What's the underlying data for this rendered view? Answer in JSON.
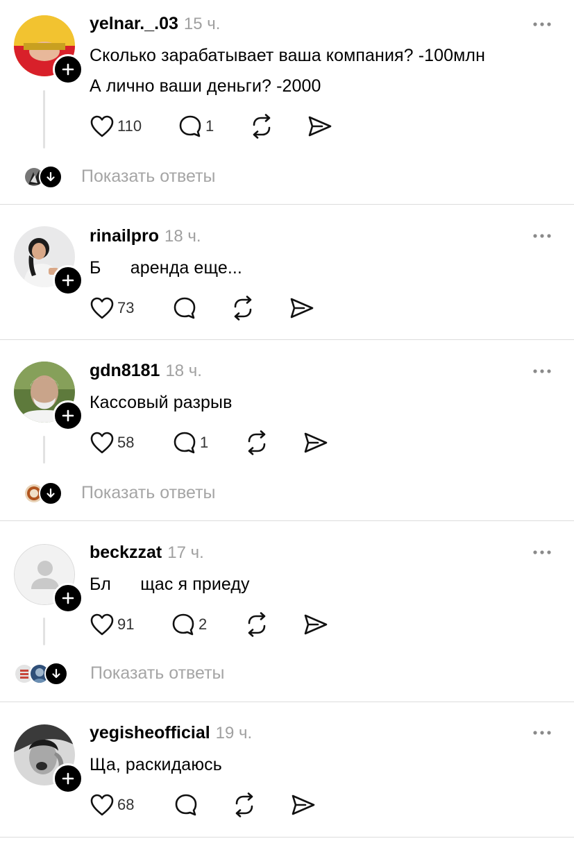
{
  "posts": [
    {
      "username": "yelnar._.03",
      "time": "15 ч.",
      "lines": [
        "Сколько  зарабатывает ваша компания? -100млн",
        "А лично ваши деньги? -2000"
      ],
      "likes": "110",
      "comments": "1",
      "show_replies": "Показать ответы"
    },
    {
      "username": "rinailpro",
      "time": "18 ч.",
      "lines": [
        "Б      аренда еще..."
      ],
      "likes": "73",
      "comments": ""
    },
    {
      "username": "gdn8181",
      "time": "18 ч.",
      "lines": [
        "Кассовый разрыв"
      ],
      "likes": "58",
      "comments": "1",
      "show_replies": "Показать ответы"
    },
    {
      "username": "beckzzat",
      "time": "17 ч.",
      "lines": [
        "Бл      щас я приеду"
      ],
      "likes": "91",
      "comments": "2",
      "show_replies": "Показать ответы"
    },
    {
      "username": "yegisheofficial",
      "time": "19 ч.",
      "lines": [
        "Ща, раскидаюсь"
      ],
      "likes": "68",
      "comments": ""
    }
  ],
  "icons": {
    "like": "heart-icon",
    "comment": "comment-bubble-icon",
    "repost": "repost-icon",
    "share": "send-icon",
    "more": "more-dots-icon",
    "follow": "plus-icon",
    "expand": "arrow-down-icon"
  },
  "colors": {
    "text": "#000000",
    "muted": "#a0a0a0",
    "divider": "#dcdcdc",
    "badge": "#000000"
  }
}
